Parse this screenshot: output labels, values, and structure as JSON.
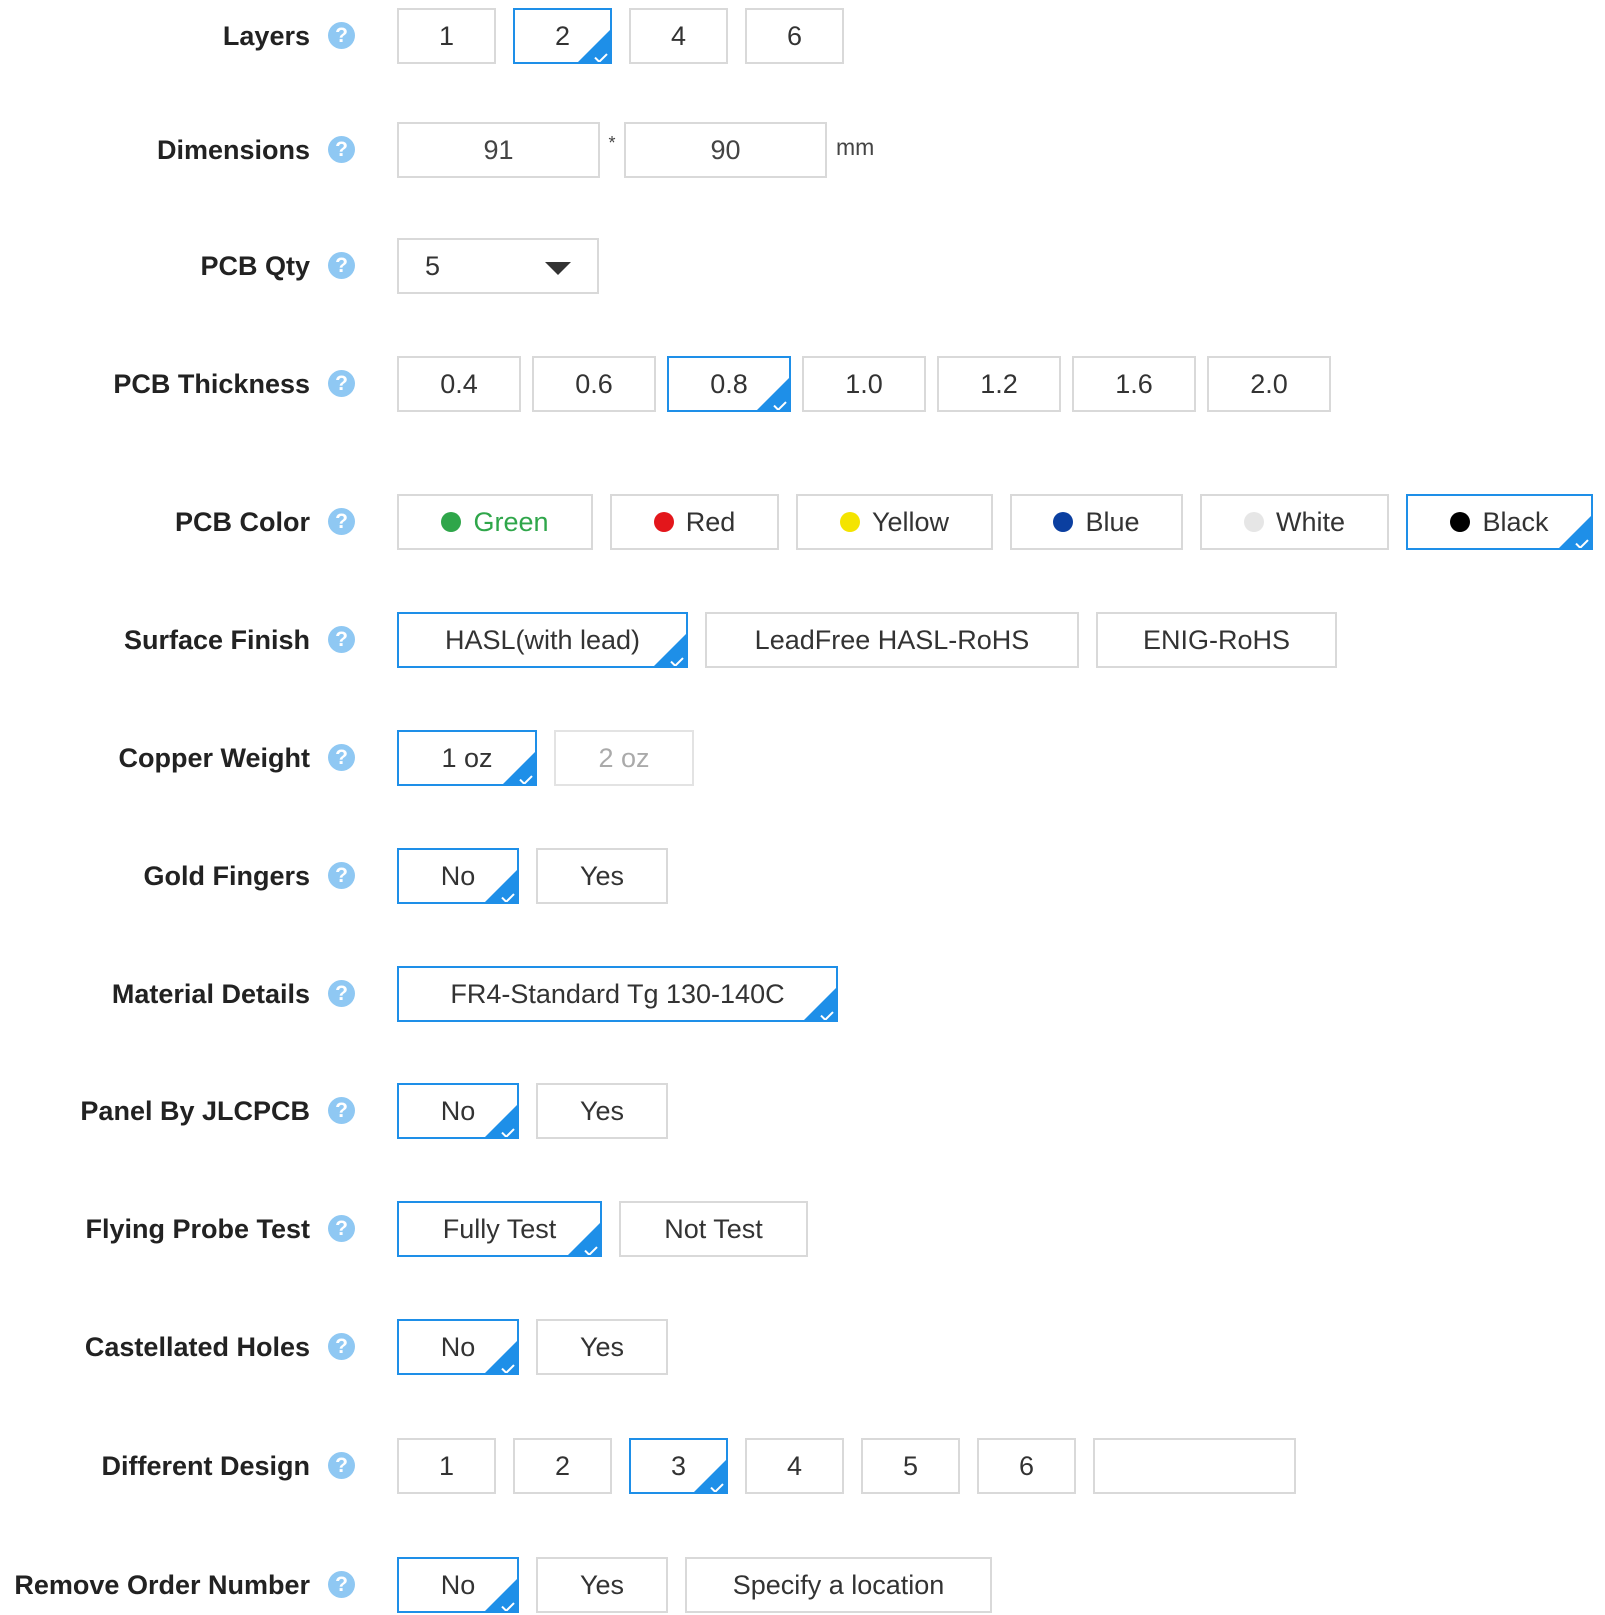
{
  "help_glyph": "?",
  "accent_color": "#1e8fe8",
  "layers": {
    "label": "Layers",
    "options": [
      "1",
      "2",
      "4",
      "6"
    ],
    "selected": "2"
  },
  "dimensions": {
    "label": "Dimensions",
    "width": "91",
    "height": "90",
    "separator": "*",
    "unit": "mm"
  },
  "pcb_qty": {
    "label": "PCB Qty",
    "value": "5"
  },
  "thickness": {
    "label": "PCB Thickness",
    "options": [
      "0.4",
      "0.6",
      "0.8",
      "1.0",
      "1.2",
      "1.6",
      "2.0"
    ],
    "selected": "0.8"
  },
  "color": {
    "label": "PCB Color",
    "options": [
      {
        "name": "Green",
        "swatch": "#2fa64a"
      },
      {
        "name": "Red",
        "swatch": "#e3161b"
      },
      {
        "name": "Yellow",
        "swatch": "#f4e400"
      },
      {
        "name": "Blue",
        "swatch": "#0b3fa0"
      },
      {
        "name": "White",
        "swatch": "#e6e6e6"
      },
      {
        "name": "Black",
        "swatch": "#000000"
      }
    ],
    "selected": "Black"
  },
  "surface_finish": {
    "label": "Surface Finish",
    "options": [
      "HASL(with lead)",
      "LeadFree HASL-RoHS",
      "ENIG-RoHS"
    ],
    "selected": "HASL(with lead)"
  },
  "copper_weight": {
    "label": "Copper Weight",
    "options": [
      "1 oz",
      "2 oz"
    ],
    "selected": "1 oz",
    "disabled": [
      "2 oz"
    ]
  },
  "gold_fingers": {
    "label": "Gold Fingers",
    "options": [
      "No",
      "Yes"
    ],
    "selected": "No"
  },
  "material": {
    "label": "Material Details",
    "options": [
      "FR4-Standard Tg 130-140C"
    ],
    "selected": "FR4-Standard Tg 130-140C"
  },
  "panel": {
    "label": "Panel By JLCPCB",
    "options": [
      "No",
      "Yes"
    ],
    "selected": "No"
  },
  "flying_probe": {
    "label": "Flying Probe Test",
    "options": [
      "Fully Test",
      "Not Test"
    ],
    "selected": "Fully Test"
  },
  "castellated": {
    "label": "Castellated Holes",
    "options": [
      "No",
      "Yes"
    ],
    "selected": "No"
  },
  "different_design": {
    "label": "Different Design",
    "options": [
      "1",
      "2",
      "3",
      "4",
      "5",
      "6"
    ],
    "selected": "3",
    "custom_value": ""
  },
  "remove_order_number": {
    "label": "Remove Order Number",
    "options": [
      "No",
      "Yes",
      "Specify a location"
    ],
    "selected": "No"
  }
}
